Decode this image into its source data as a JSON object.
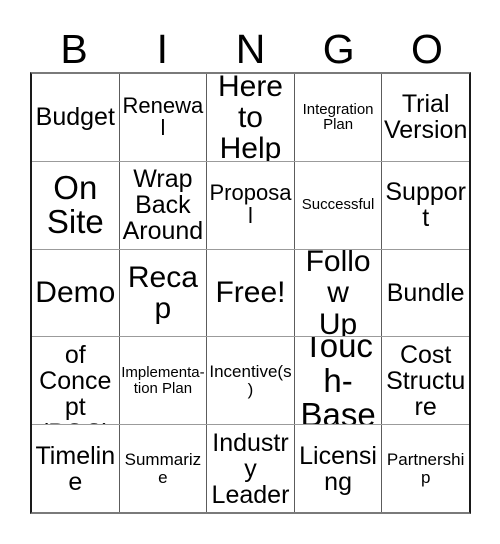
{
  "card": {
    "header_letters": [
      "B",
      "I",
      "N",
      "G",
      "O"
    ],
    "free_space_label": "Free!",
    "grid": [
      [
        {
          "text": "Budget",
          "size": "md"
        },
        {
          "text": "Renewal",
          "size": "sm"
        },
        {
          "text": "Here\nto Help",
          "size": "lg"
        },
        {
          "text": "Integration\nPlan",
          "size": "xxs"
        },
        {
          "text": "Trial\nVersion",
          "size": "md"
        }
      ],
      [
        {
          "text": "On\nSite",
          "size": "xl"
        },
        {
          "text": "Wrap\nBack\nAround",
          "size": "md"
        },
        {
          "text": "Proposal",
          "size": "sm"
        },
        {
          "text": "Successful",
          "size": "xxs"
        },
        {
          "text": "Support",
          "size": "md"
        }
      ],
      [
        {
          "text": "Demo",
          "size": "lg"
        },
        {
          "text": "Recap",
          "size": "lg"
        },
        {
          "text": "Free!",
          "size": "lg"
        },
        {
          "text": "Follow\nUp",
          "size": "lg"
        },
        {
          "text": "Bundle",
          "size": "md"
        }
      ],
      [
        {
          "text": "Proof of\nConcept\n(POC)",
          "size": "md"
        },
        {
          "text": "Implementa-\ntion Plan",
          "size": "xxs"
        },
        {
          "text": "Incentive(s)",
          "size": "xs"
        },
        {
          "text": "Touch-\nBase",
          "size": "xl"
        },
        {
          "text": "Cost\nStructure",
          "size": "md"
        }
      ],
      [
        {
          "text": "Timeline",
          "size": "md"
        },
        {
          "text": "Summarize",
          "size": "xs"
        },
        {
          "text": "Industry\nLeader",
          "size": "md"
        },
        {
          "text": "Licensing",
          "size": "md"
        },
        {
          "text": "Partnership",
          "size": "xs"
        }
      ]
    ]
  },
  "colors": {
    "background": "#ffffff",
    "text": "#000000",
    "inner_border": "#5c5c5c",
    "outer_border": "#1a1a1a"
  }
}
